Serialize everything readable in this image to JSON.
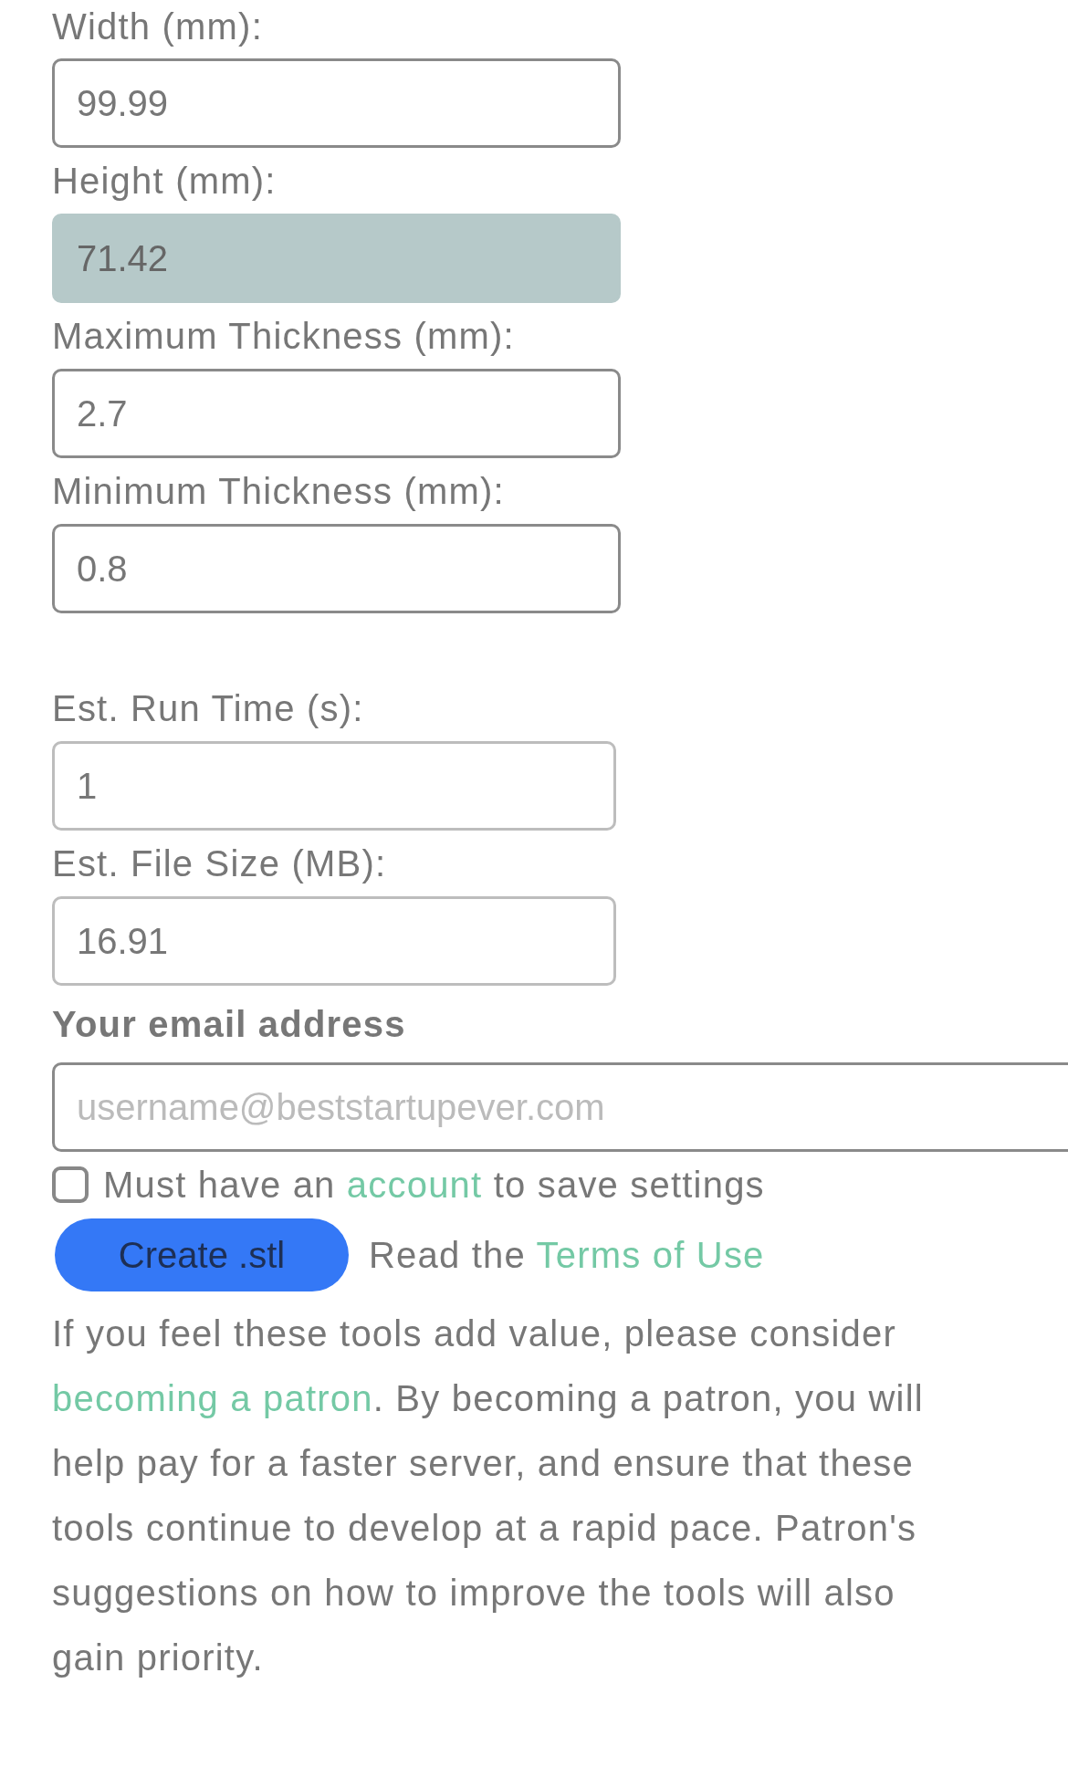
{
  "fields": [
    {
      "label": "Width (mm):",
      "value": "99.99",
      "disabled": false,
      "readonly": false
    },
    {
      "label": "Height (mm):",
      "value": "71.42",
      "disabled": true,
      "readonly": false
    },
    {
      "label": "Maximum Thickness (mm):",
      "value": "2.7",
      "disabled": false,
      "readonly": false
    },
    {
      "label": "Minimum Thickness (mm):",
      "value": "0.8",
      "disabled": false,
      "readonly": false
    }
  ],
  "estimates": [
    {
      "label": "Est. Run Time (s):",
      "value": "1",
      "disabled": false,
      "readonly": true
    },
    {
      "label": "Est. File Size (MB):",
      "value": "16.91",
      "disabled": false,
      "readonly": true
    }
  ],
  "email": {
    "heading": "Your email address",
    "placeholder": "username@beststartupever.com"
  },
  "save_settings": {
    "checked": false,
    "before": "Must have an",
    "link": "account",
    "after": "to save settings"
  },
  "create_button": "Create .stl",
  "terms": {
    "before": "Read the",
    "link": "Terms of Use"
  },
  "patron": {
    "before": "If you feel these tools add value, please consider",
    "link": "becoming a patron",
    "after": ". By becoming a patron, you will help pay for a faster server, and ensure that these tools continue to develop at a rapid pace. Patron's suggestions on how to improve the tools will also gain priority."
  }
}
